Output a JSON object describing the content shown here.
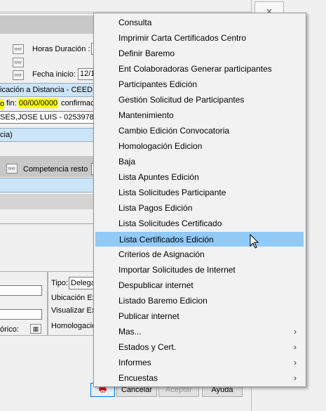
{
  "background": {
    "close_glyph": "×",
    "horas_label": "Horas Duración :",
    "fecha_inicio_label": "Fecha inicio:",
    "fecha_inicio_value": "12/1",
    "ubicacion_text": "icación a Distancia - CEED. Va",
    "fin_prefix": "o",
    "fin_label": "fin:",
    "fin_value": "00/00/0000",
    "confirmacion_label": "confirmac",
    "persona_text": "SES,JOSE LUIS - 0253978855",
    "paren_text": "cia)",
    "competencia_label": "Competencia resto",
    "tipo_label": "Tipo:",
    "tipo_value": "Delega",
    "ubicacion_ex_label": "Ubicación Ex",
    "visualizar_ex_label": "Visualizar Exp",
    "homologacion_label": "Homologació",
    "historico_label": "órico:"
  },
  "buttons": {
    "cancelar": "Cancelar",
    "aceptar": "Aceptar",
    "ayuda": "Ayuda"
  },
  "menu": {
    "items": [
      {
        "label": "Consulta",
        "submenu": false
      },
      {
        "label": "Imprimir Carta Certificados Centro",
        "submenu": false
      },
      {
        "label": "Definir Baremo",
        "submenu": false
      },
      {
        "label": "Ent Colaboradoras Generar participantes",
        "submenu": false
      },
      {
        "label": "Participantes Edición",
        "submenu": false
      },
      {
        "label": "Gestión Solicitud de Participantes",
        "submenu": false
      },
      {
        "label": "Mantenimiento",
        "submenu": false
      },
      {
        "label": "Cambio Edición Convocatoria",
        "submenu": false
      },
      {
        "label": "Homologación Edicion",
        "submenu": false
      },
      {
        "label": "Baja",
        "submenu": false
      },
      {
        "label": "Lista Apuntes Edición",
        "submenu": false
      },
      {
        "label": "Lista Solicitudes Participante",
        "submenu": false
      },
      {
        "label": "Lista Pagos Edición",
        "submenu": false
      },
      {
        "label": "Lista Solicitudes Certificado",
        "submenu": false
      },
      {
        "label": "Lista Certificados Edición",
        "submenu": false,
        "highlighted": true
      },
      {
        "label": "Criterios de Asignación",
        "submenu": false
      },
      {
        "label": "Importar Solicitudes de Internet",
        "submenu": false
      },
      {
        "label": "Despublicar internet",
        "submenu": false
      },
      {
        "label": "Listado Baremo Edicion",
        "submenu": false
      },
      {
        "label": "Publicar internet",
        "submenu": false
      },
      {
        "label": "Mas...",
        "submenu": true
      },
      {
        "label": "Estados y Cert.",
        "submenu": true
      },
      {
        "label": "Informes",
        "submenu": true
      },
      {
        "label": "Encuestas",
        "submenu": true
      }
    ],
    "submenu_arrow": "›"
  },
  "colors": {
    "highlight": "#91c9f7",
    "blue_band": "#cce4f7",
    "yellow_field": "#ffff00"
  }
}
